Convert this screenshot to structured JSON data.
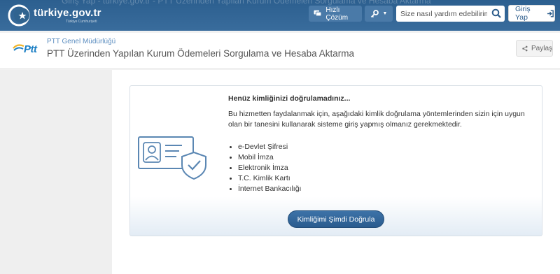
{
  "topbar": {
    "ghost_text": "Giriş Yap - türkiye.gov.tr - PTT Üzerinden Yapılan Kurum Ödemeleri Sorgulama ve Hesaba Aktarma",
    "brand": "türkiye.gov.tr",
    "brand_tag": "Türkiye Cumhuriyeti",
    "quick_solution": "Hızlı Çözüm",
    "search_placeholder": "Size nasıl yardım edebilirim?",
    "login": "Giriş Yap",
    "icons": {
      "quick": "chat-icon",
      "access": "key-icon",
      "search": "search-icon",
      "login": "sign-in-icon"
    }
  },
  "header": {
    "org_logo": "Ptt",
    "org": "PTT Genel Müdürlüğü",
    "title": "PTT Üzerinden Yapılan Kurum Ödemeleri Sorgulama ve Hesaba Aktarma",
    "share": "Paylaş"
  },
  "card": {
    "title": "Henüz kimliğinizi doğrulamadınız...",
    "description": "Bu hizmetten faydalanmak için, aşağıdaki kimlik doğrulama yöntemlerinden sizin için uygun olan bir tanesini kullanarak sisteme giriş yapmış olmanız gerekmektedir.",
    "methods": [
      "e-Devlet Şifresi",
      "Mobil İmza",
      "Elektronik İmza",
      "T.C. Kimlik Kartı",
      "İnternet Bankacılığı"
    ],
    "button": "Kimliğimi Şimdi Doğrula"
  },
  "colors": {
    "topbar": "#2c5f8f",
    "accent": "#2a5c8e",
    "org_link": "#5a8cbf",
    "illustration": "#5b87b3"
  }
}
